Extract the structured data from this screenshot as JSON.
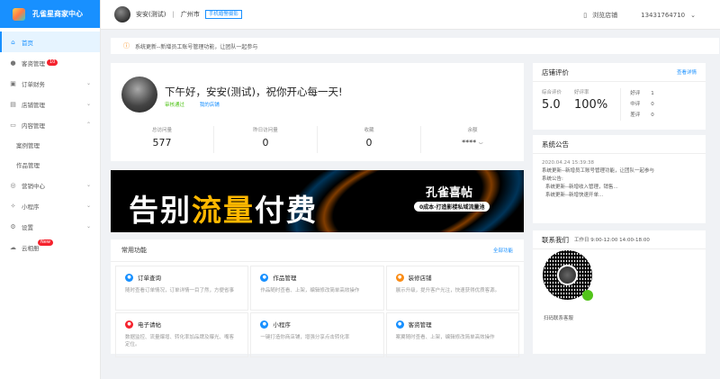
{
  "brand": {
    "title": "孔雀星商家中心"
  },
  "sidebar": {
    "items": [
      {
        "label": "首页",
        "icon": "home-icon",
        "active": true
      },
      {
        "label": "客资管理",
        "icon": "user-icon",
        "badge": "10"
      },
      {
        "label": "订单财务",
        "icon": "cart-icon"
      },
      {
        "label": "店铺管理",
        "icon": "store-icon"
      },
      {
        "label": "内容管理",
        "icon": "document-icon"
      },
      {
        "label": "案例管理",
        "sub": true
      },
      {
        "label": "作品管理",
        "sub": true
      },
      {
        "label": "营销中心",
        "icon": "marketing-icon"
      },
      {
        "label": "小程序",
        "icon": "miniapp-icon"
      },
      {
        "label": "设置",
        "icon": "settings-icon"
      },
      {
        "label": "云相册",
        "icon": "cloud-icon",
        "badge": "New"
      }
    ]
  },
  "topbar": {
    "name": "安安(测试)",
    "city": "广州市",
    "tag": "手机婚警摄影",
    "browse": "浏览店铺",
    "phone": "13431764710"
  },
  "notice": {
    "text": "系统更新--新增员工账号管理功能，让团队一起参与"
  },
  "welcome": {
    "greeting": "下午好，安安(测试)，祝你开心每一天!",
    "status": "审核通过",
    "my_store": "我的店铺",
    "stats": [
      {
        "label": "总访问量",
        "value": "577"
      },
      {
        "label": "昨日访问量",
        "value": "0"
      },
      {
        "label": "收藏",
        "value": "0"
      },
      {
        "label": "余额",
        "value": "****"
      }
    ]
  },
  "banner": {
    "main_a": "告别",
    "main_b": "流量",
    "main_c": "付费",
    "brand": "孔雀喜帖",
    "slogan": "0成本·打造影楼私域流量池"
  },
  "functions": {
    "title": "常用功能",
    "all": "全部功能",
    "items": [
      {
        "title": "订单查询",
        "desc": "随时查看订单情况，订单详情一目了然，方便省事",
        "color": "#1890ff"
      },
      {
        "title": "作品管理",
        "desc": "作品随时查看、上架，编辑修改简单高效操作",
        "color": "#1890ff"
      },
      {
        "title": "装修店铺",
        "desc": "展示升级，提升客户光注，快速获得优质客源。",
        "color": "#fa8c16"
      },
      {
        "title": "电子请帖",
        "desc": "数据监控、流量爆增、转化率加品牌及曝光、嘴客定位。",
        "color": "#f5222d"
      },
      {
        "title": "小程序",
        "desc": "一键打造你商店铺，增强分享点击转化率",
        "color": "#1890ff"
      },
      {
        "title": "客资管理",
        "desc": "案翼随时查看、上架，编辑修改简单高效操作",
        "color": "#1890ff"
      }
    ]
  },
  "rating": {
    "title": "店铺评价",
    "link": "查看详情",
    "overall_label": "综合评价",
    "overall": "5.0",
    "good_rate_label": "好评率",
    "good_rate": "100%",
    "breakdown": [
      {
        "label": "好评",
        "count": "1"
      },
      {
        "label": "中评",
        "count": "0"
      },
      {
        "label": "差评",
        "count": "0"
      }
    ]
  },
  "announcement": {
    "title": "系统公告",
    "time": "2020.04.24 15:39:38",
    "line1": "系统更新--新增员工账号管理功能，让团队一起参与",
    "line2": "系统公告:",
    "line3": "系统更新--新增收入管理，销售...",
    "line4": "系统更新--新增快速开单..."
  },
  "contact": {
    "title": "联系我们",
    "hours": "工作日 9:00-12:00  14:00-18:00",
    "caption": "扫码联系客服"
  }
}
